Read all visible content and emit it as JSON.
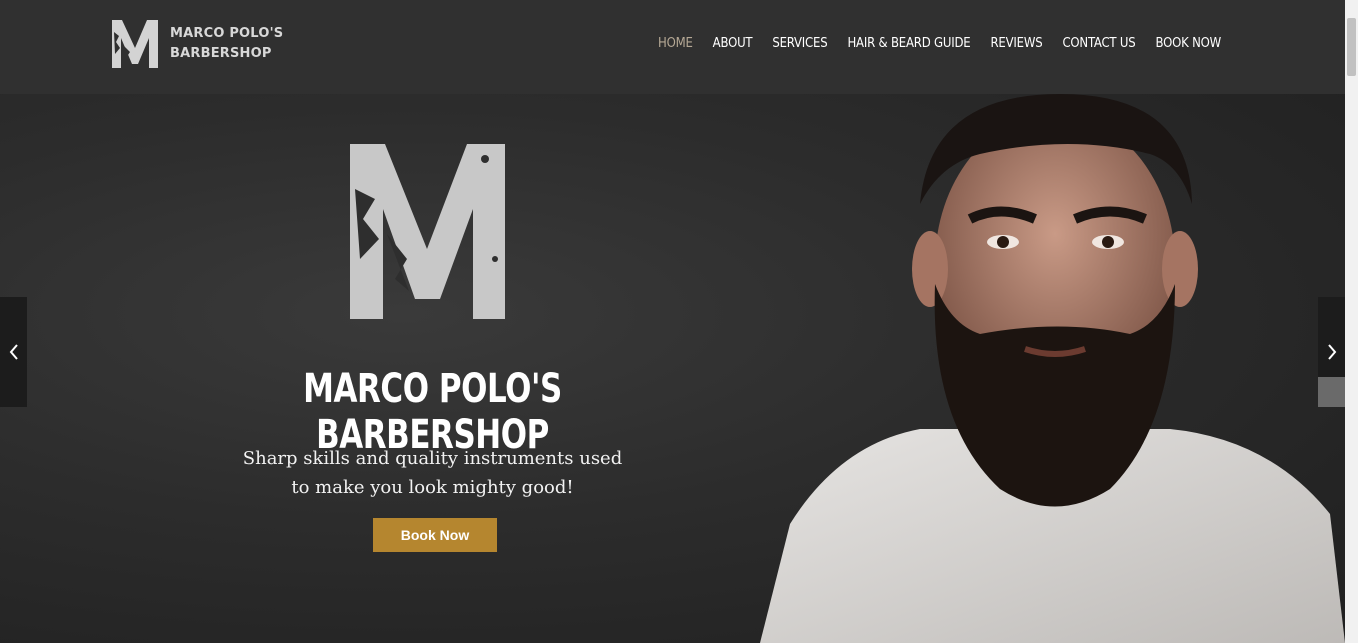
{
  "header": {
    "logo_line1": "MARCO POLO'S",
    "logo_line2": "BARBERSHOP",
    "nav": [
      {
        "label": "HOME",
        "active": true
      },
      {
        "label": "ABOUT"
      },
      {
        "label": "SERVICES"
      },
      {
        "label": "HAIR & BEARD GUIDE"
      },
      {
        "label": "REVIEWS"
      },
      {
        "label": "CONTACT US"
      },
      {
        "label": "BOOK NOW"
      }
    ]
  },
  "hero": {
    "title": "MARCO POLO'S BARBERSHOP",
    "subtitle_line1": "Sharp skills and quality instruments used",
    "subtitle_line2": "to make you look mighty good!",
    "button_label": "Book Now",
    "prev_icon": "chevron-left-icon",
    "next_icon": "chevron-right-icon"
  },
  "colors": {
    "header_bg": "#303030",
    "nav_active": "#b5a895",
    "button_bg": "#b5862f",
    "hero_bg": "#2c2c2c"
  }
}
